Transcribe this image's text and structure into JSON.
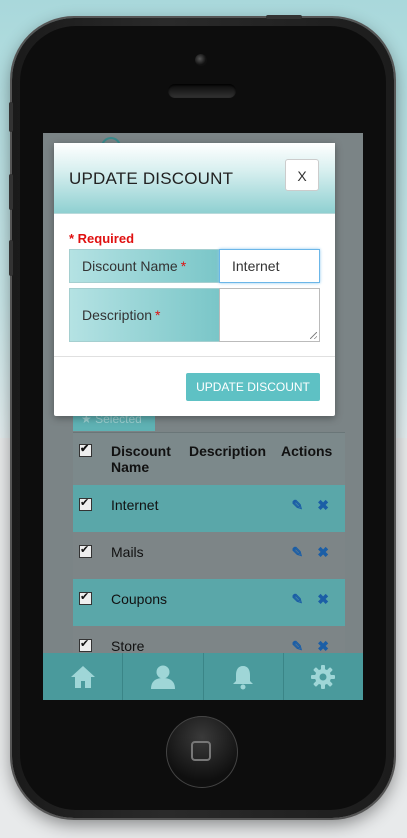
{
  "modal": {
    "title": "UPDATE DISCOUNT",
    "close_label": "X",
    "required_label": "* Required",
    "fields": [
      {
        "label": "Discount Name",
        "required_mark": "*",
        "value": "Internet"
      },
      {
        "label": "Description",
        "required_mark": "*",
        "value": ""
      }
    ],
    "submit_label": "UPDATE DISCOUNT"
  },
  "background": {
    "selected_tab_label": "Selected",
    "table": {
      "headers": [
        "Discount Name",
        "Description",
        "Actions"
      ],
      "rows": [
        {
          "name": "Internet",
          "description": "",
          "checked": true
        },
        {
          "name": "Mails",
          "description": "",
          "checked": true
        },
        {
          "name": "Coupons",
          "description": "",
          "checked": true
        },
        {
          "name": "Store",
          "description": "",
          "checked": true
        }
      ]
    }
  },
  "footer_nav": [
    {
      "icon": "home-icon"
    },
    {
      "icon": "user-icon"
    },
    {
      "icon": "bell-icon"
    },
    {
      "icon": "gear-icon"
    }
  ],
  "colors": {
    "accent": "#5ec1c4",
    "required": "#e01010",
    "footer": "#4a9a9c"
  }
}
